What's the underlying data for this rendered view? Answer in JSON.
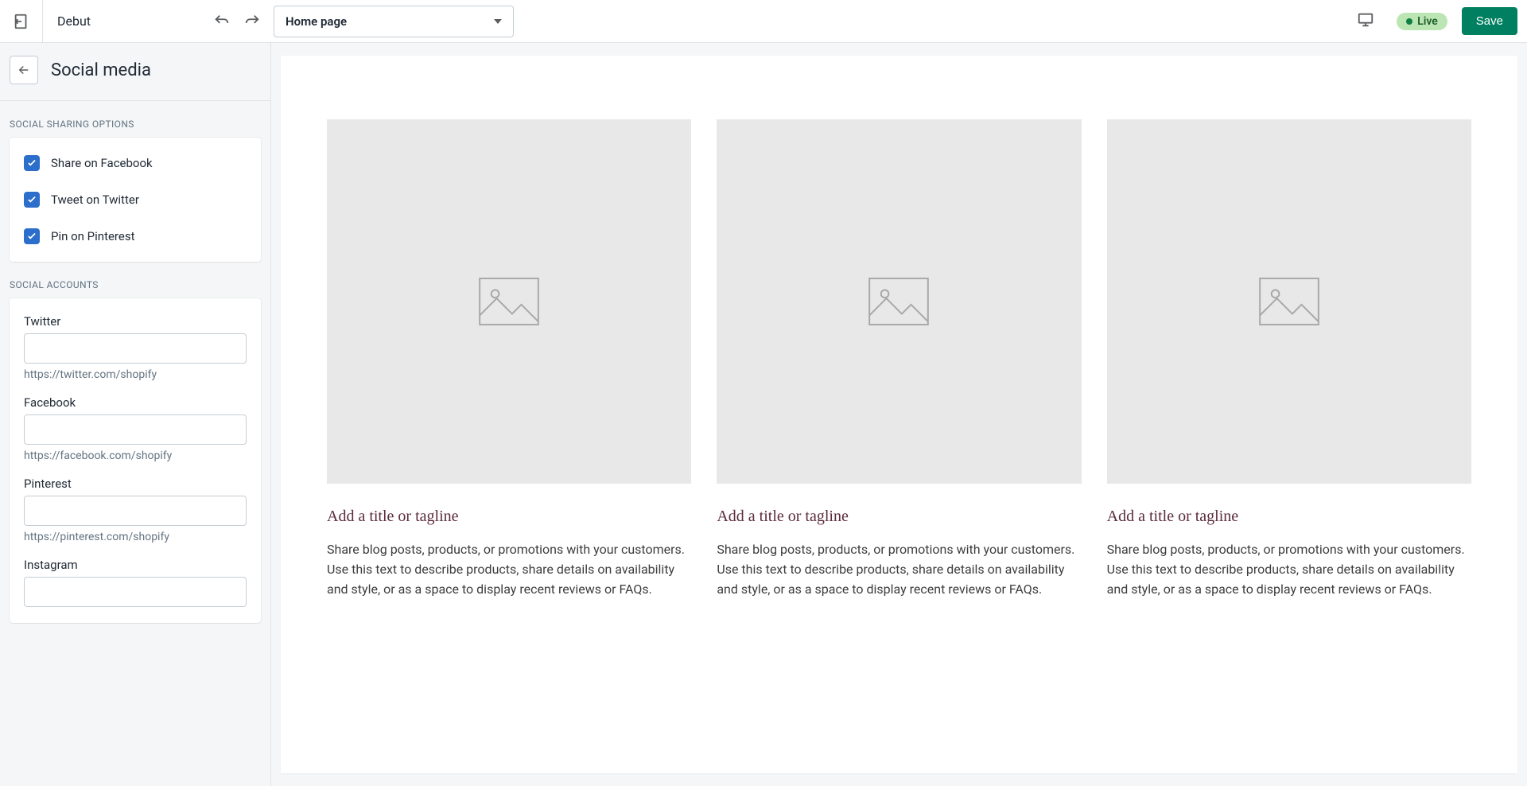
{
  "topbar": {
    "theme_name": "Debut",
    "page_selector_value": "Home page",
    "live_label": "Live",
    "save_label": "Save"
  },
  "sidebar": {
    "section_title": "Social media",
    "group_sharing_label": "Social sharing options",
    "sharing_options": [
      {
        "label": "Share on Facebook",
        "checked": true
      },
      {
        "label": "Tweet on Twitter",
        "checked": true
      },
      {
        "label": "Pin on Pinterest",
        "checked": true
      }
    ],
    "group_accounts_label": "Social accounts",
    "accounts": [
      {
        "label": "Twitter",
        "value": "",
        "help": "https://twitter.com/shopify"
      },
      {
        "label": "Facebook",
        "value": "",
        "help": "https://facebook.com/shopify"
      },
      {
        "label": "Pinterest",
        "value": "",
        "help": "https://pinterest.com/shopify"
      },
      {
        "label": "Instagram",
        "value": "",
        "help": ""
      }
    ]
  },
  "preview": {
    "items": [
      {
        "title": "Add a title or tagline",
        "body": "Share blog posts, products, or promotions with your customers. Use this text to describe products, share details on availability and style, or as a space to display recent reviews or FAQs."
      },
      {
        "title": "Add a title or tagline",
        "body": "Share blog posts, products, or promotions with your customers. Use this text to describe products, share details on availability and style, or as a space to display recent reviews or FAQs."
      },
      {
        "title": "Add a title or tagline",
        "body": "Share blog posts, products, or promotions with your customers. Use this text to describe products, share details on availability and style, or as a space to display recent reviews or FAQs."
      }
    ]
  }
}
